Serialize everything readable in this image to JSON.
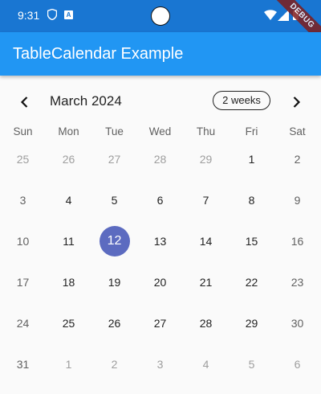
{
  "status_bar": {
    "time": "9:31",
    "app_icon_letter": "A",
    "icons": [
      "shield-icon",
      "app-icon",
      "camera-cutout",
      "wifi-icon",
      "signal-icon",
      "battery-icon"
    ]
  },
  "debug_banner": "DEBUG",
  "app_bar": {
    "title": "TableCalendar Example"
  },
  "calendar": {
    "month_title": "March 2024",
    "format_button": "2 weeks",
    "nav": {
      "prev_icon": "chevron-left-icon",
      "next_icon": "chevron-right-icon"
    },
    "days_of_week": [
      "Sun",
      "Mon",
      "Tue",
      "Wed",
      "Thu",
      "Fri",
      "Sat"
    ],
    "today": "12",
    "weeks": [
      [
        {
          "d": "25",
          "outside": true
        },
        {
          "d": "26",
          "outside": true
        },
        {
          "d": "27",
          "outside": true
        },
        {
          "d": "28",
          "outside": true
        },
        {
          "d": "29",
          "outside": true
        },
        {
          "d": "1"
        },
        {
          "d": "2"
        }
      ],
      [
        {
          "d": "3"
        },
        {
          "d": "4"
        },
        {
          "d": "5"
        },
        {
          "d": "6"
        },
        {
          "d": "7"
        },
        {
          "d": "8"
        },
        {
          "d": "9"
        }
      ],
      [
        {
          "d": "10"
        },
        {
          "d": "11"
        },
        {
          "d": "12",
          "today": true
        },
        {
          "d": "13"
        },
        {
          "d": "14"
        },
        {
          "d": "15"
        },
        {
          "d": "16"
        }
      ],
      [
        {
          "d": "17"
        },
        {
          "d": "18"
        },
        {
          "d": "19"
        },
        {
          "d": "20"
        },
        {
          "d": "21"
        },
        {
          "d": "22"
        },
        {
          "d": "23"
        }
      ],
      [
        {
          "d": "24"
        },
        {
          "d": "25"
        },
        {
          "d": "26"
        },
        {
          "d": "27"
        },
        {
          "d": "28"
        },
        {
          "d": "29"
        },
        {
          "d": "30"
        }
      ],
      [
        {
          "d": "31"
        },
        {
          "d": "1",
          "outside": true
        },
        {
          "d": "2",
          "outside": true
        },
        {
          "d": "3",
          "outside": true
        },
        {
          "d": "4",
          "outside": true
        },
        {
          "d": "5",
          "outside": true
        },
        {
          "d": "6",
          "outside": true
        }
      ]
    ]
  },
  "colors": {
    "status_bar": "#1976d2",
    "app_bar": "#2196f3",
    "today_marker": "#5c6bc0",
    "outside_day": "#9e9e9e",
    "weekend_day": "#616161"
  }
}
